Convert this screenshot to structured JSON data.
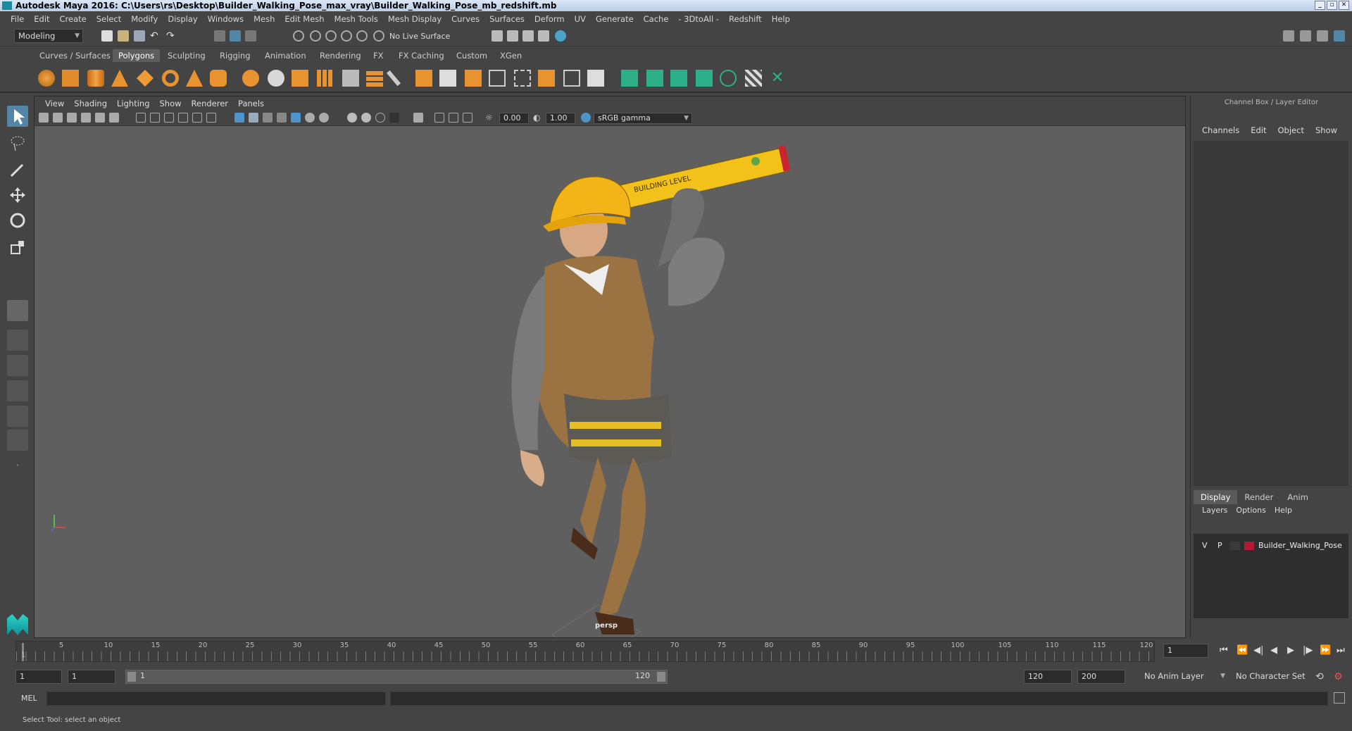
{
  "window": {
    "title": "Autodesk Maya 2016: C:\\Users\\rs\\Desktop\\Builder_Walking_Pose_max_vray\\Builder_Walking_Pose_mb_redshift.mb"
  },
  "menubar": [
    "File",
    "Edit",
    "Create",
    "Select",
    "Modify",
    "Display",
    "Windows",
    "Mesh",
    "Edit Mesh",
    "Mesh Tools",
    "Mesh Display",
    "Curves",
    "Surfaces",
    "Deform",
    "UV",
    "Generate",
    "Cache",
    "- 3DtoAll -",
    "Redshift",
    "Help"
  ],
  "statusline": {
    "mode": "Modeling",
    "live_surface": "No Live Surface"
  },
  "shelf_tabs": [
    "Curves / Surfaces",
    "Polygons",
    "Sculpting",
    "Rigging",
    "Animation",
    "Rendering",
    "FX",
    "FX Caching",
    "Custom",
    "XGen"
  ],
  "shelf_active": "Polygons",
  "viewport": {
    "menu": [
      "View",
      "Shading",
      "Lighting",
      "Show",
      "Renderer",
      "Panels"
    ],
    "exposure": "0.00",
    "gamma": "1.00",
    "color_space": "sRGB gamma",
    "camera_label": "persp"
  },
  "channel_box": {
    "title": "Channel Box / Layer Editor",
    "menu": [
      "Channels",
      "Edit",
      "Object",
      "Show"
    ],
    "tabs": [
      "Display",
      "Render",
      "Anim"
    ],
    "layer_menu": [
      "Layers",
      "Options",
      "Help"
    ],
    "layer": {
      "v": "V",
      "p": "P",
      "name": "Builder_Walking_Pose",
      "color": "#b01a35"
    }
  },
  "timeline": {
    "ticks": [
      "1",
      "5",
      "10",
      "15",
      "20",
      "25",
      "30",
      "35",
      "40",
      "45",
      "50",
      "55",
      "60",
      "65",
      "70",
      "75",
      "80",
      "85",
      "90",
      "95",
      "100",
      "105",
      "110",
      "115",
      "120"
    ],
    "current_frame": "1"
  },
  "range": {
    "start": "1",
    "playback_start": "1",
    "slider_start": "1",
    "slider_end": "120",
    "playback_end": "120",
    "end": "200",
    "anim_layer": "No Anim Layer",
    "character_set": "No Character Set"
  },
  "cmdline": {
    "label": "MEL"
  },
  "helpline": "Select Tool: select an object",
  "colors": {
    "accent": "#5285a6",
    "viewport_bg": "#5f5f5f"
  }
}
